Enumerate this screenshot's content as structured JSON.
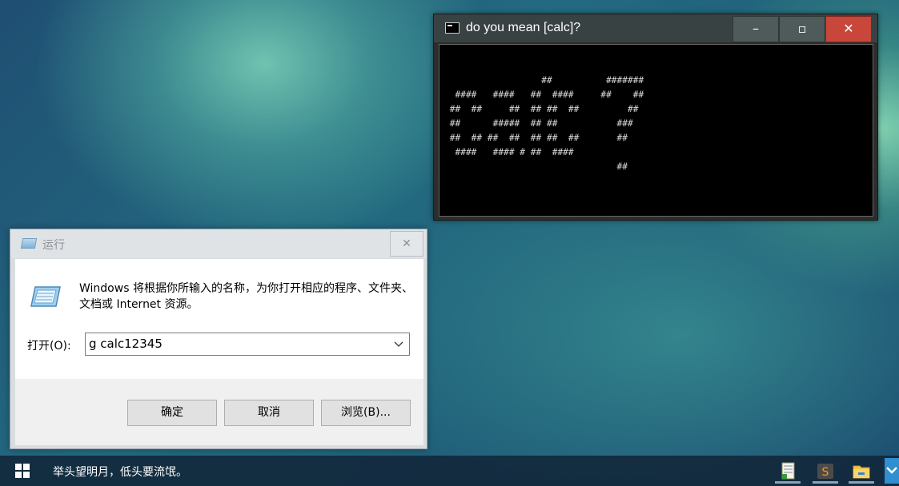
{
  "console": {
    "title": "do you mean [calc]?",
    "minimize": "–",
    "maximize": "▫",
    "close": "✕",
    "ascii_lines": [
      "",
      "",
      "                  ##          #######",
      "  ####   ####   ##  ####     ##    ##",
      " ##  ##     ##  ## ##  ##         ##",
      " ##      #####  ## ##           ###",
      " ##  ## ##  ##  ## ##  ##       ##",
      "  ####   #### # ##  ####",
      "                                ##"
    ]
  },
  "run_dialog": {
    "title": "运行",
    "close": "✕",
    "description": "Windows 将根据你所输入的名称，为你打开相应的程序、文件夹、文档或 Internet 资源。",
    "open_label": "打开(O):",
    "input_value": "g calc12345",
    "ok": "确定",
    "cancel": "取消",
    "browse": "浏览(B)..."
  },
  "taskbar": {
    "poem": "举头望明月，低头要流氓。",
    "icons": [
      "notepad-icon",
      "sublime-icon",
      "folder-icon",
      "app-icon"
    ]
  }
}
